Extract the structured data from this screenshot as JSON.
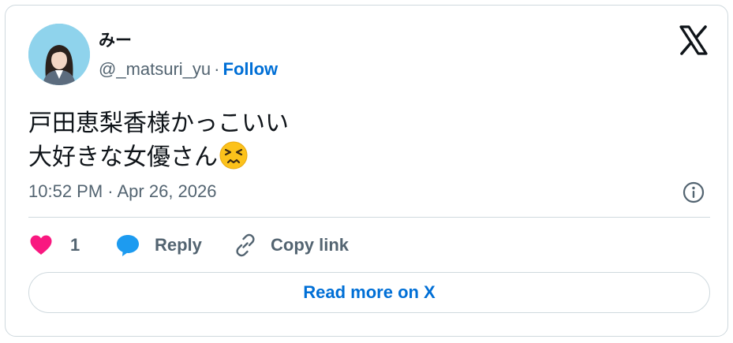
{
  "author": {
    "display_name": "みー",
    "handle": "@_matsuri_yu",
    "separator": "·",
    "follow_label": "Follow"
  },
  "tweet": {
    "lines": [
      "戸田恵梨香様かっこいい",
      "大好きな女優さん"
    ],
    "emoji": "persevering-face",
    "timestamp": "10:52 PM · Apr 26, 2026"
  },
  "actions": {
    "like_count": "1",
    "reply_label": "Reply",
    "copy_link_label": "Copy link"
  },
  "footer": {
    "read_more_label": "Read more on X"
  },
  "colors": {
    "like": "#f91880",
    "reply": "#1d9bf0",
    "link": "#006fd6",
    "muted": "#536471",
    "text": "#0f1419",
    "border": "#cfd9de"
  }
}
